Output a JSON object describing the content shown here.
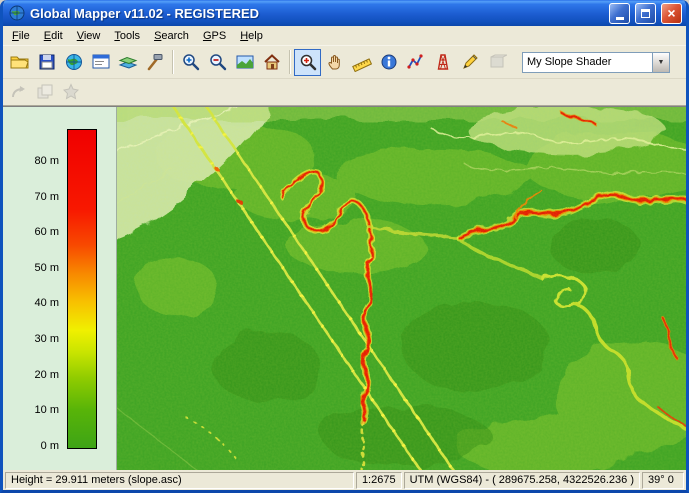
{
  "window": {
    "title": "Global Mapper v11.02 - REGISTERED"
  },
  "icons": {
    "close_glyph": "×",
    "combo_arrow_glyph": "▼"
  },
  "menu": {
    "items": [
      "File",
      "Edit",
      "View",
      "Tools",
      "Search",
      "GPS",
      "Help"
    ]
  },
  "toolbar": {
    "shader_combo": {
      "value": "My Slope Shader"
    }
  },
  "legend": {
    "labels": [
      "80 m",
      "70 m",
      "60 m",
      "50 m",
      "40 m",
      "30 m",
      "20 m",
      "10 m",
      "0 m"
    ],
    "gradient_colors": [
      "#f00000",
      "#f84800",
      "#f8c000",
      "#f0f000",
      "#90cc00",
      "#3ea416"
    ]
  },
  "map": {
    "base_color": "#3ba224",
    "ridge_color": "#e41800"
  },
  "statusbar": {
    "height_text": "Height = 29.911 meters (slope.asc)",
    "scale": "1:2675",
    "position": "UTM (WGS84) - ( 289675.258, 4322526.236 )",
    "angle": "39° 0"
  }
}
